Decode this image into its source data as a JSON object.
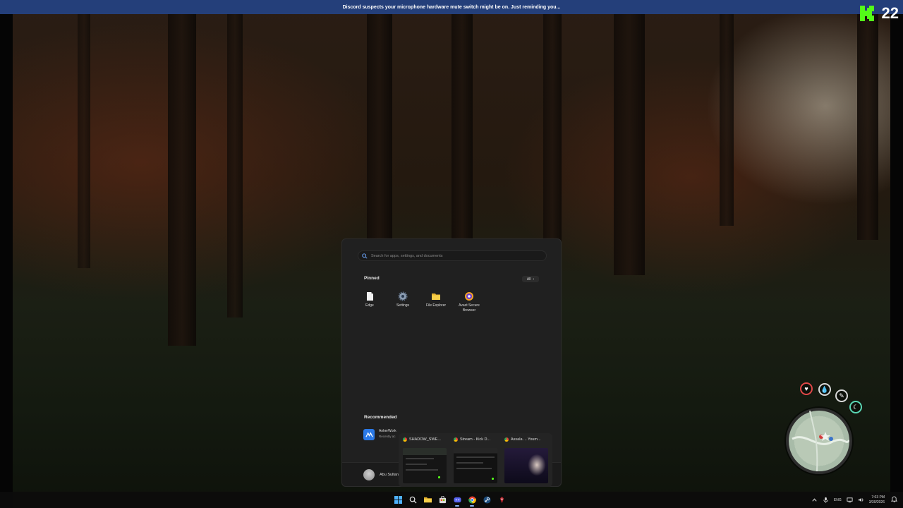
{
  "banner": {
    "text": "Discord suspects your microphone hardware mute switch might be on. Just reminding you..."
  },
  "kick_overlay": {
    "count": "22",
    "logo_color": "#53fc18"
  },
  "start_menu": {
    "search_placeholder": "Search for apps, settings, and documents",
    "pinned_label": "Pinned",
    "all_label": "All",
    "pinned": [
      {
        "label": "Edge",
        "icon": "document-icon"
      },
      {
        "label": "Settings",
        "icon": "gear-icon"
      },
      {
        "label": "File Explorer",
        "icon": "folder-icon"
      },
      {
        "label": "Avast Secure Browser",
        "icon": "avast-browser-icon"
      }
    ],
    "recommended_label": "Recommended",
    "recommended": [
      {
        "name": "AnkerWork",
        "sub": "Recently ac",
        "icon": "ankerwork-icon"
      }
    ],
    "user_name": "Abu Sultan"
  },
  "thumbnails": [
    {
      "title": "SHADOW_SWE..."
    },
    {
      "title": "Stream - Kick D..."
    },
    {
      "title": "Assala ... Youm..."
    }
  ],
  "taskbar": {
    "apps": [
      "start-icon",
      "search-icon",
      "file-explorer-icon",
      "store-icon",
      "discord-icon",
      "chrome-icon",
      "steam-icon",
      "game-icon"
    ],
    "language": "ENG",
    "time": "7:03 PM",
    "date": "3/30/2026"
  },
  "colors": {
    "accent": "#53fc18",
    "banner": "#243f7a"
  }
}
